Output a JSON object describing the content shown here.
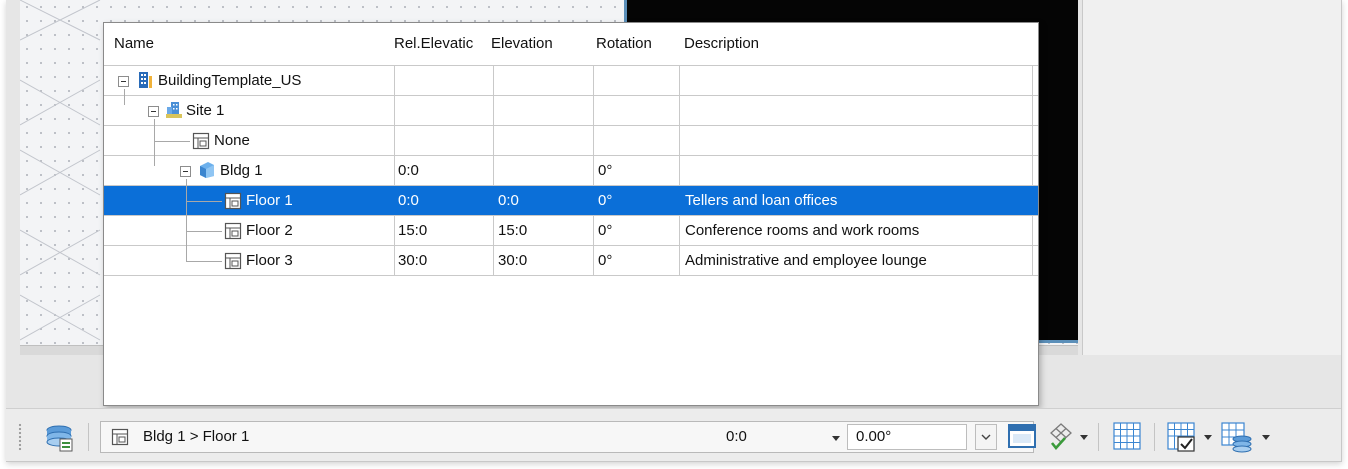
{
  "grid": {
    "columns": {
      "name": "Name",
      "rel_elevation": "Rel.Elevatic",
      "elevation": "Elevation",
      "rotation": "Rotation",
      "description": "Description"
    },
    "rows": [
      {
        "name": "BuildingTemplate_US",
        "rel_elevation": "",
        "elevation": "",
        "rotation": "",
        "description": "",
        "icon": "building-template-icon"
      },
      {
        "name": "Site 1",
        "rel_elevation": "",
        "elevation": "",
        "rotation": "",
        "description": "",
        "icon": "site-icon"
      },
      {
        "name": "None",
        "rel_elevation": "",
        "elevation": "",
        "rotation": "",
        "description": "",
        "icon": "floor-icon"
      },
      {
        "name": "Bldg 1",
        "rel_elevation": "0:0",
        "elevation": "",
        "rotation": "0°",
        "description": "",
        "icon": "building-icon"
      },
      {
        "name": "Floor 1",
        "rel_elevation": "0:0",
        "elevation": "0:0",
        "rotation": "0°",
        "description": "Tellers and loan offices",
        "icon": "floor-icon",
        "selected": true
      },
      {
        "name": "Floor 2",
        "rel_elevation": "15:0",
        "elevation": "15:0",
        "rotation": "0°",
        "description": "Conference rooms and work rooms",
        "icon": "floor-icon"
      },
      {
        "name": "Floor 3",
        "rel_elevation": "30:0",
        "elevation": "30:0",
        "rotation": "0°",
        "description": "Administrative and employee lounge",
        "icon": "floor-icon"
      }
    ]
  },
  "statusbar": {
    "location_path": "Bldg 1 > Floor 1",
    "elevation_value": "0:0",
    "rotation_value": "0.00°"
  },
  "colors": {
    "selection": "#0b6fd8",
    "grid_line": "#c9c9c9",
    "canvas_border": "#5b8fb9"
  }
}
